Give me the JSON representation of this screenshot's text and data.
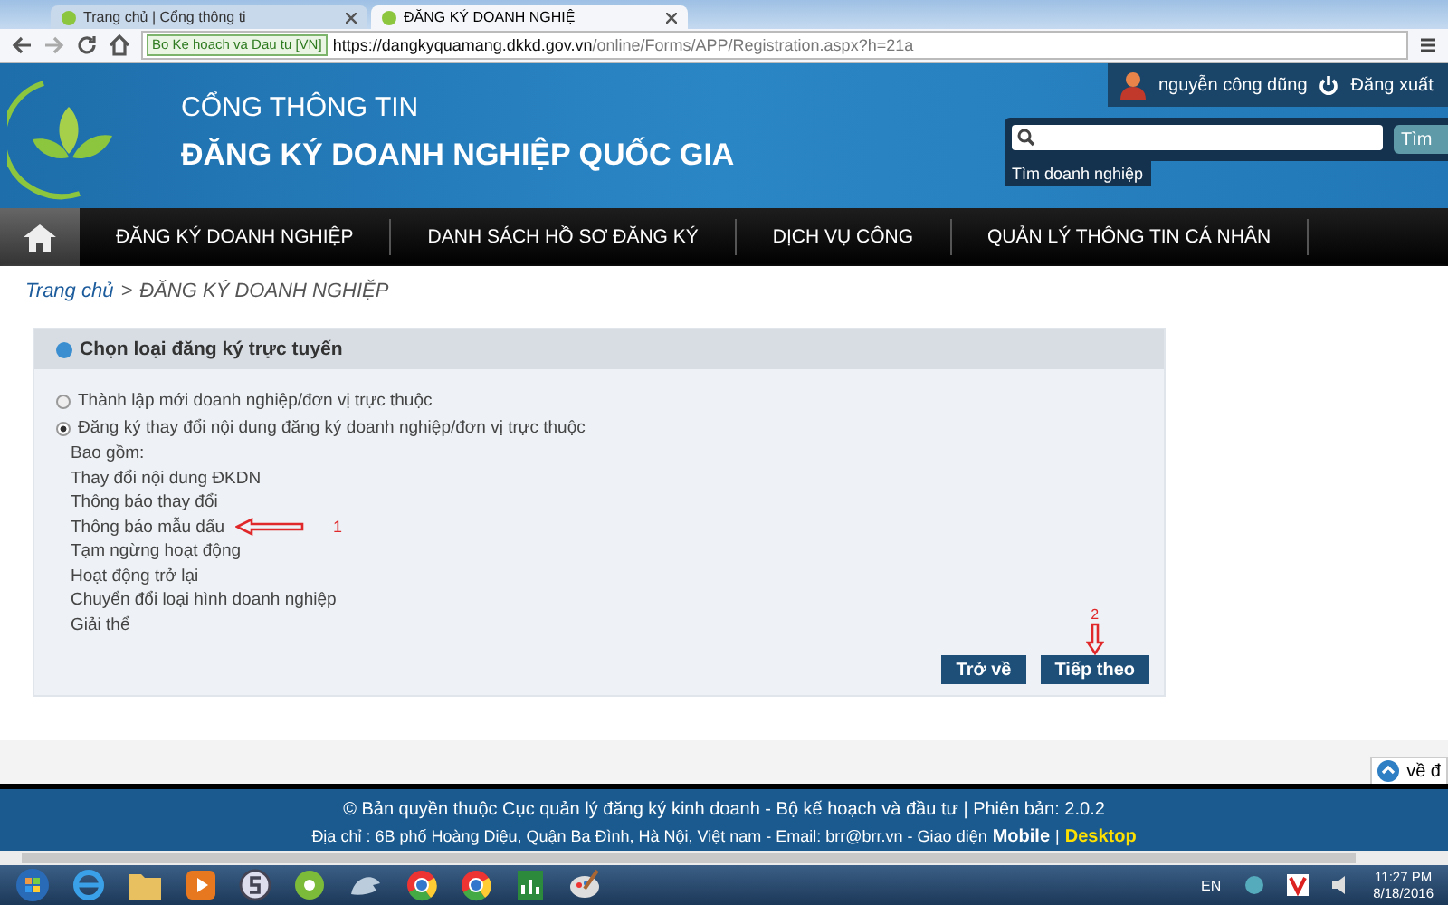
{
  "browser": {
    "tabs": [
      {
        "title": "Trang chủ | Cổng thông ti",
        "selected": false
      },
      {
        "title": "ĐĂNG KÝ DOANH NGHIỆ",
        "selected": true
      }
    ],
    "site_badge": "Bo Ke hoach va Dau tu [VN]",
    "url_host": "https://dangkyquamang.dkkd.gov.vn",
    "url_path": "/online/Forms/APP/Registration.aspx?h=21a"
  },
  "header": {
    "subtitle": "CỔNG THÔNG TIN",
    "title": "ĐĂNG KÝ DOANH NGHIỆP QUỐC GIA",
    "user_name": "nguyễn công dũng",
    "logout": "Đăng xuất",
    "search_button": "Tìm",
    "search_hint": "Tìm doanh nghiệp"
  },
  "nav": {
    "items": [
      "ĐĂNG KÝ DOANH NGHIỆP",
      "DANH SÁCH HỒ SƠ ĐĂNG KÝ",
      "DỊCH VỤ CÔNG",
      "QUẢN LÝ THÔNG TIN CÁ NHÂN"
    ]
  },
  "breadcrumb": {
    "link": "Trang chủ",
    "separator": ">",
    "current": "ĐĂNG KÝ DOANH NGHIỆP"
  },
  "panel": {
    "title": "Chọn loại đăng ký trực tuyến",
    "options": [
      {
        "label": "Thành lập mới doanh nghiệp/đơn vị trực thuộc",
        "selected": false
      },
      {
        "label": "Đăng ký thay đổi nội dung đăng ký doanh nghiệp/đơn vị trực thuộc",
        "selected": true
      }
    ],
    "includes_label": "Bao gồm:",
    "includes": [
      {
        "text": "Thay đổi nội dung ĐKDN"
      },
      {
        "text": "Thông báo thay đổi"
      },
      {
        "text": "Thông báo mẫu dấu",
        "note": "1"
      },
      {
        "text": "Tạm ngừng hoạt động"
      },
      {
        "text": "Hoạt động trở lại"
      },
      {
        "text": "Chuyển đổi loại hình doanh nghiệp"
      },
      {
        "text": "Giải thể"
      }
    ],
    "buttons": [
      {
        "label": "Trở về"
      },
      {
        "label": "Tiếp theo",
        "note": "2"
      }
    ]
  },
  "back_to_top": "về đ",
  "footer": {
    "copyright": "© Bản quyền thuộc Cục quản lý đăng ký kinh doanh - Bộ kế hoạch và đầu tư | Phiên bản: 2.0.2",
    "address": "Địa chỉ : 6B phố Hoàng Diệu, Quận Ba Đình, Hà Nội, Việt nam - Email: brr@brr.vn - Giao diện",
    "mobile": "Mobile",
    "divider": "|",
    "desktop": "Desktop"
  },
  "taskbar": {
    "language": "EN",
    "time": "11:27 PM",
    "date": "8/18/2016"
  }
}
